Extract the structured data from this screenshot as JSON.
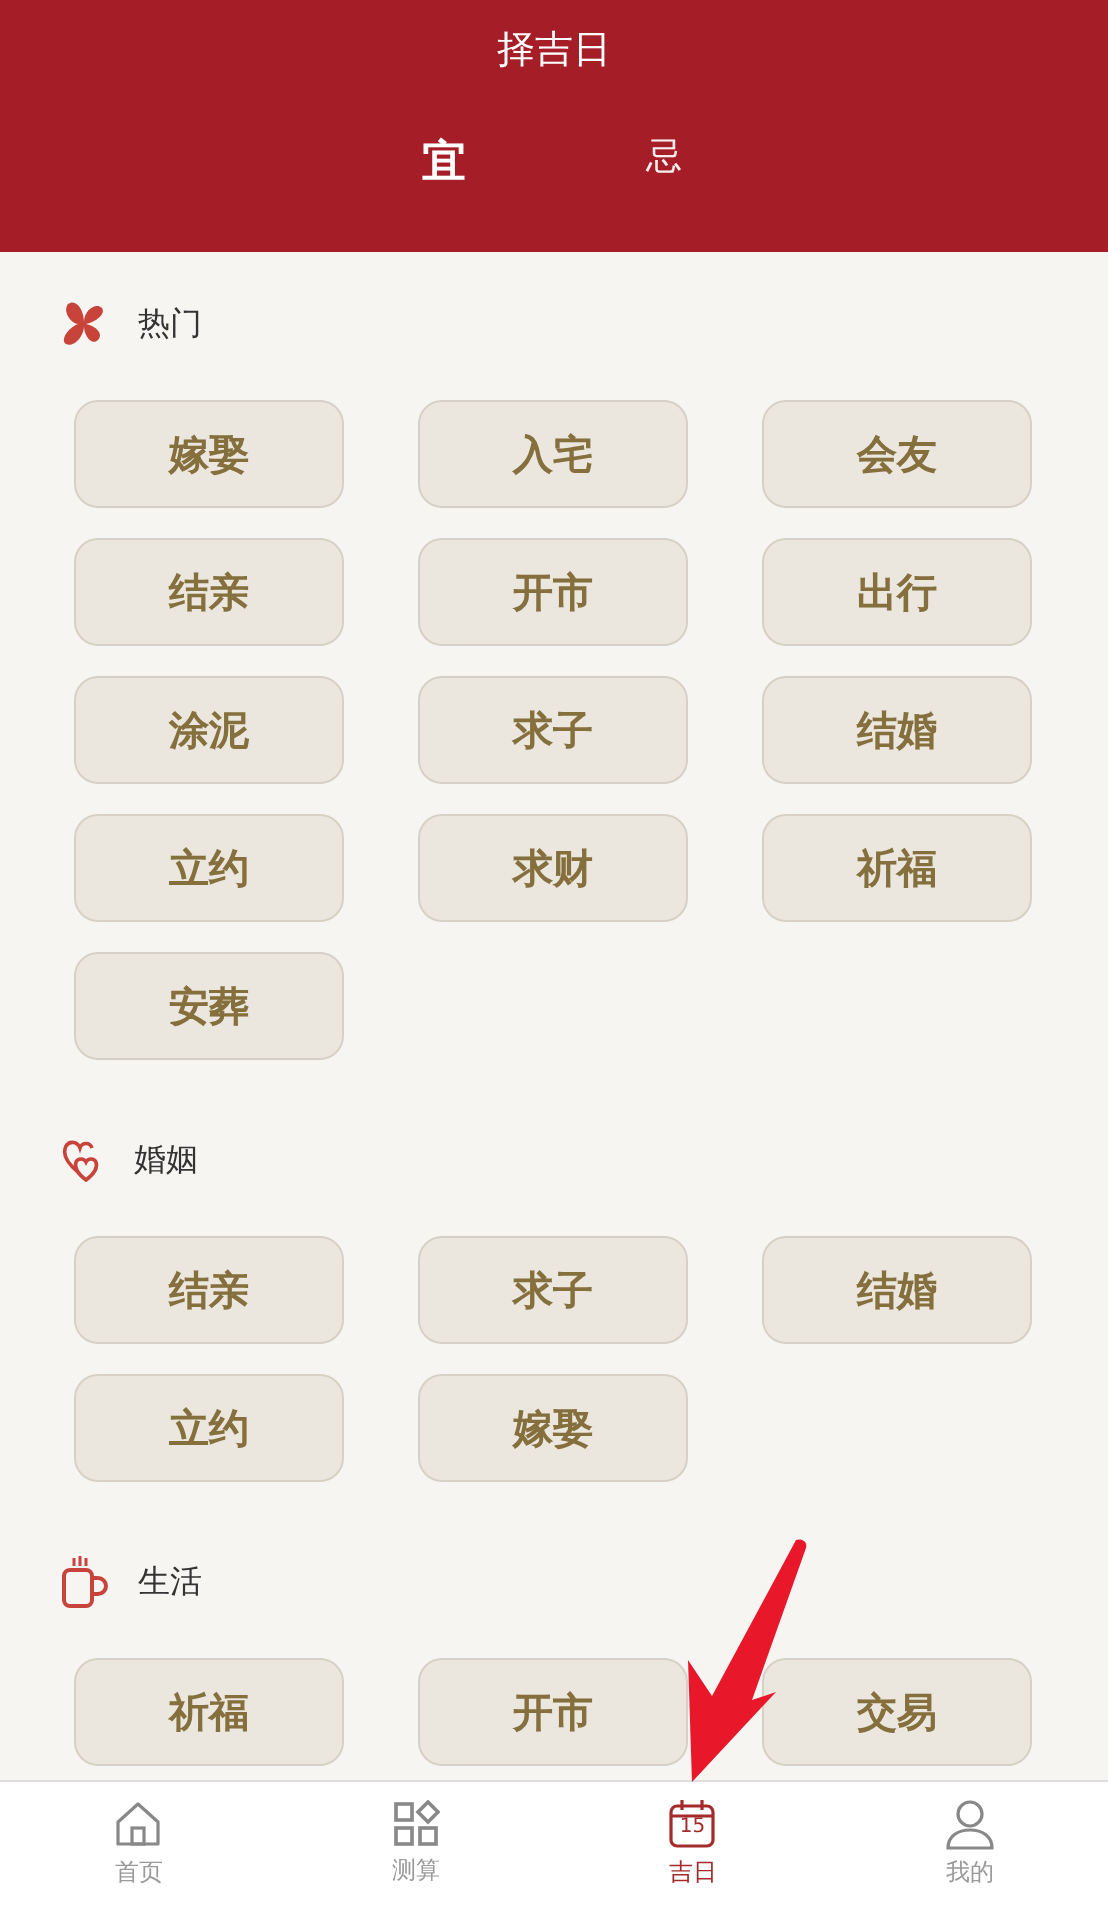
{
  "header": {
    "title": "择吉日",
    "tabs": [
      {
        "label": "宜",
        "selected": true
      },
      {
        "label": "忌",
        "selected": false
      }
    ]
  },
  "sections": [
    {
      "kind": "hot",
      "title": "热门",
      "items": [
        "嫁娶",
        "入宅",
        "会友",
        "结亲",
        "开市",
        "出行",
        "涂泥",
        "求子",
        "结婚",
        "立约",
        "求财",
        "祈福",
        "安葬"
      ]
    },
    {
      "kind": "marriage",
      "title": "婚姻",
      "items": [
        "结亲",
        "求子",
        "结婚",
        "立约",
        "嫁娶"
      ]
    },
    {
      "kind": "life",
      "title": "生活",
      "items": [
        "祈福",
        "开市",
        "交易"
      ]
    }
  ],
  "tab_bar": [
    {
      "kind": "home",
      "label": "首页",
      "selected": false
    },
    {
      "kind": "tools",
      "label": "测算",
      "selected": false
    },
    {
      "kind": "calendar",
      "label": "吉日",
      "icon_text": "15",
      "selected": true
    },
    {
      "kind": "profile",
      "label": "我的",
      "selected": false
    }
  ]
}
